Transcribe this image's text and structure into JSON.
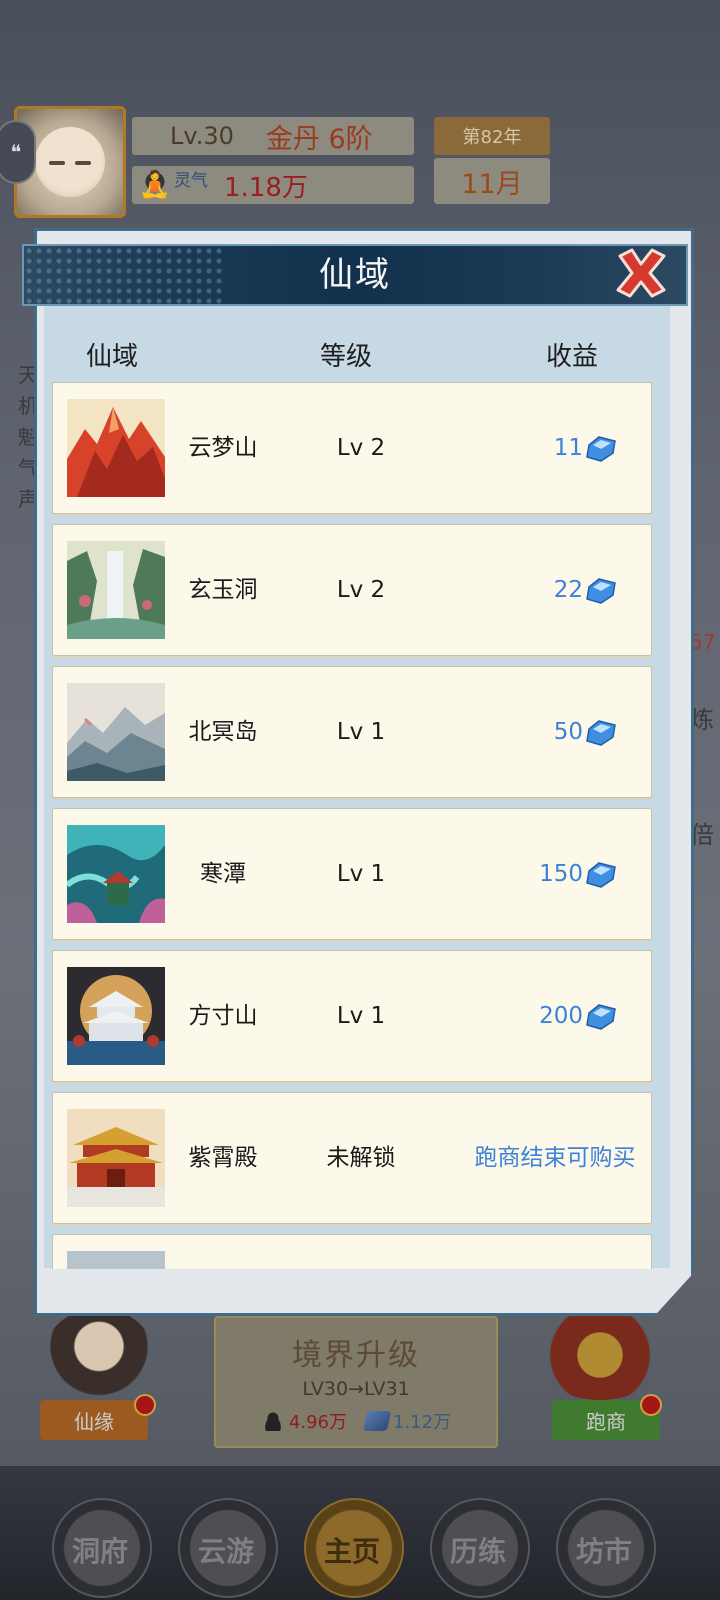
{
  "hud": {
    "level": "Lv.30",
    "rank": "金丹 6阶",
    "qi_label": "灵气",
    "qi_value": "1.18万",
    "year": "第82年",
    "month": "11月"
  },
  "bottom": {
    "xianyuan_label": "仙缘",
    "paoshang_label": "跑商",
    "upgrade_title": "境界升级",
    "upgrade_lv": "LV30→LV31",
    "cost_qi": "4.96万",
    "cost_gem": "1.12万"
  },
  "nav": {
    "items": [
      {
        "label": "洞府",
        "active": false
      },
      {
        "label": "云游",
        "active": false
      },
      {
        "label": "主页",
        "active": true
      },
      {
        "label": "历练",
        "active": false
      },
      {
        "label": "坊市",
        "active": false
      }
    ]
  },
  "side": {
    "left_chars": [
      "天",
      "机",
      "魁",
      "气",
      "声"
    ],
    "right_chars": [
      "57",
      "炼",
      "倍"
    ]
  },
  "modal": {
    "title": "仙域",
    "columns": {
      "name": "仙域",
      "level": "等级",
      "income": "收益"
    },
    "rows": [
      {
        "name": "云梦山",
        "level": "Lv 2",
        "income": "11",
        "thumb": "red-mountain"
      },
      {
        "name": "玄玉洞",
        "level": "Lv 2",
        "income": "22",
        "thumb": "waterfall-valley"
      },
      {
        "name": "北冥岛",
        "level": "Lv 1",
        "income": "50",
        "thumb": "misty-mountains"
      },
      {
        "name": "寒潭",
        "level": "Lv 1",
        "income": "150",
        "thumb": "dragon-pool"
      },
      {
        "name": "方寸山",
        "level": "Lv 1",
        "income": "200",
        "thumb": "moon-palace"
      },
      {
        "name": "紫霄殿",
        "level": "未解锁",
        "status": "跑商结束可购买",
        "thumb": "golden-palace"
      }
    ]
  },
  "colors": {
    "income_blue": "#3d82d8",
    "header_navy": "#12314c",
    "row_bg": "#fcf9ea",
    "close_red": "#d63a2e"
  }
}
